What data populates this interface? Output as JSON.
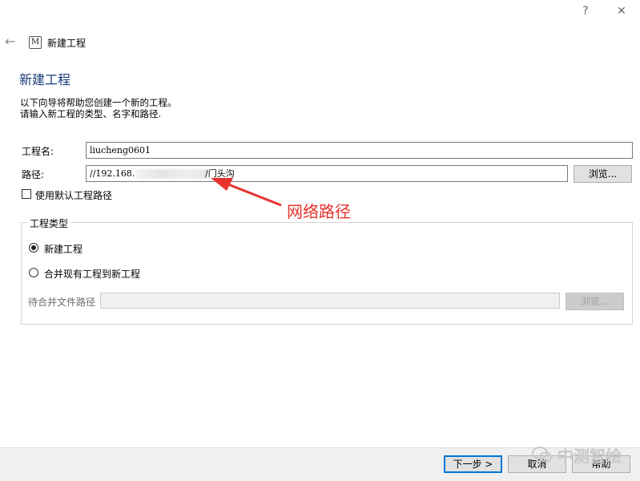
{
  "window": {
    "title": "新建工程",
    "app_icon_letter": "M",
    "help_glyph": "?",
    "close_glyph": "✕",
    "back_glyph": "←"
  },
  "page": {
    "title": "新建工程",
    "desc_line1": "以下向导将帮助您创建一个新的工程。",
    "desc_line2": "请输入新工程的类型、名字和路径."
  },
  "form": {
    "name_label": "工程名:",
    "name_value": "liucheng0601",
    "path_label": "路径:",
    "path_prefix": "//192.168.",
    "path_suffix": "/门头沟",
    "browse_label": "浏览...",
    "default_path_label": "使用默认工程路径"
  },
  "annotation": {
    "text": "网络路径"
  },
  "project_type": {
    "title": "工程类型",
    "option_new": "新建工程",
    "option_merge": "合并现有工程到新工程",
    "merge_path_label": "待合并文件路径",
    "merge_browse_label": "浏览..."
  },
  "footer": {
    "next_label": "下一步 >",
    "cancel_label": "取消",
    "help_label": "帮助",
    "watermark": "中测智绘"
  }
}
